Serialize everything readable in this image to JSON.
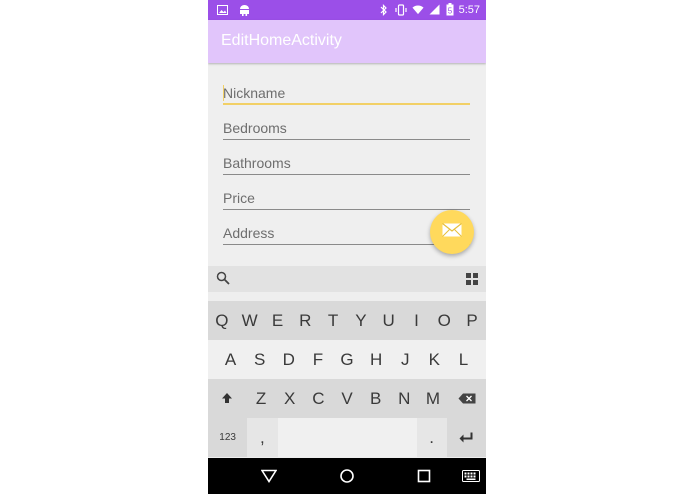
{
  "status_bar": {
    "time": "5:57",
    "battery_level": "5",
    "icons": [
      "image-icon",
      "android-icon",
      "bluetooth-icon",
      "vibrate-icon",
      "wifi-icon",
      "signal-icon",
      "battery-icon"
    ],
    "color": "#9b4fe8"
  },
  "app_bar": {
    "title": "EditHomeActivity",
    "color": "#e1c5fb"
  },
  "form": {
    "fields": [
      {
        "placeholder": "Nickname",
        "value": ""
      },
      {
        "placeholder": "Bedrooms",
        "value": ""
      },
      {
        "placeholder": "Bathrooms",
        "value": ""
      },
      {
        "placeholder": "Price",
        "value": ""
      },
      {
        "placeholder": "Address",
        "value": ""
      }
    ],
    "accent_color": "#f2d066"
  },
  "fab": {
    "icon": "mail-icon",
    "color": "#ffd95c"
  },
  "keyboard": {
    "row1": [
      "Q",
      "W",
      "E",
      "R",
      "T",
      "Y",
      "U",
      "I",
      "O",
      "P"
    ],
    "row2": [
      "A",
      "S",
      "D",
      "F",
      "G",
      "H",
      "J",
      "K",
      "L"
    ],
    "row3": [
      "Z",
      "X",
      "C",
      "V",
      "B",
      "N",
      "M"
    ],
    "bottom": {
      "symbols": "123",
      "comma": ",",
      "period": "."
    }
  }
}
